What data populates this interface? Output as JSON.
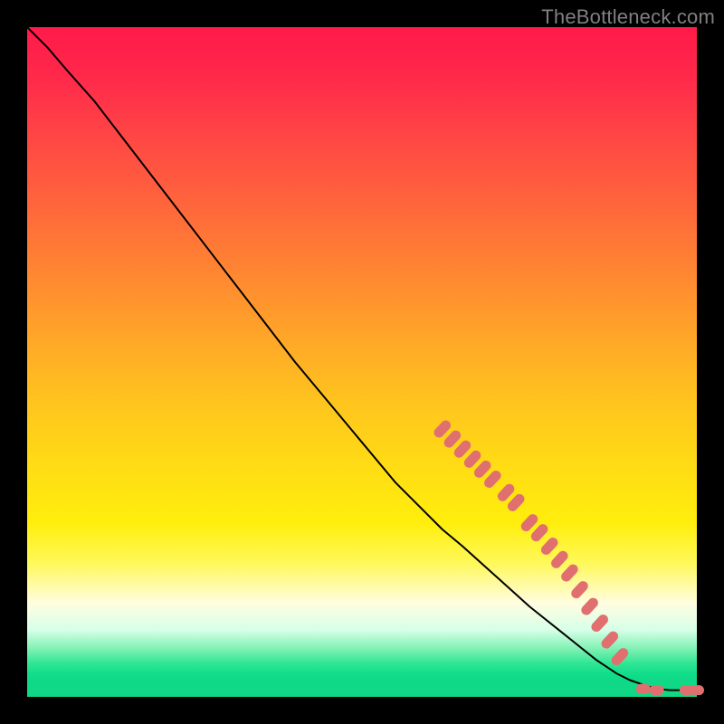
{
  "watermark": "TheBottleneck.com",
  "colors": {
    "frame": "#000000",
    "curve": "#000000",
    "marker_fill": "#e07070",
    "marker_stroke": "#b85a5a"
  },
  "chart_data": {
    "type": "line",
    "title": "",
    "xlabel": "",
    "ylabel": "",
    "xlim": [
      0,
      100
    ],
    "ylim": [
      0,
      100
    ],
    "grid": false,
    "legend": false,
    "series": [
      {
        "name": "curve",
        "x": [
          0,
          3,
          6,
          10,
          15,
          20,
          25,
          30,
          35,
          40,
          45,
          50,
          55,
          60,
          62,
          65,
          70,
          75,
          80,
          85,
          88,
          90,
          92,
          94,
          96,
          98,
          100
        ],
        "values": [
          100,
          97,
          93.5,
          89,
          82.5,
          76,
          69.5,
          63,
          56.5,
          50,
          44,
          38,
          32,
          27,
          25,
          22.5,
          18,
          13.5,
          9.5,
          5.5,
          3.5,
          2.5,
          1.8,
          1.2,
          1.0,
          1.0,
          1.0
        ]
      }
    ],
    "markers": [
      {
        "x": 62.0,
        "y": 40.0
      },
      {
        "x": 63.5,
        "y": 38.5
      },
      {
        "x": 65.0,
        "y": 37.0
      },
      {
        "x": 66.5,
        "y": 35.5
      },
      {
        "x": 68.0,
        "y": 34.0
      },
      {
        "x": 69.5,
        "y": 32.5
      },
      {
        "x": 71.5,
        "y": 30.5
      },
      {
        "x": 73.0,
        "y": 29.0
      },
      {
        "x": 75.0,
        "y": 26.0
      },
      {
        "x": 76.5,
        "y": 24.5
      },
      {
        "x": 78.0,
        "y": 22.5
      },
      {
        "x": 79.5,
        "y": 20.5
      },
      {
        "x": 81.0,
        "y": 18.5
      },
      {
        "x": 82.5,
        "y": 16.0
      },
      {
        "x": 84.0,
        "y": 13.5
      },
      {
        "x": 85.5,
        "y": 11.0
      },
      {
        "x": 87.0,
        "y": 8.5
      },
      {
        "x": 88.5,
        "y": 6.0
      },
      {
        "x": 92.0,
        "y": 1.2
      },
      {
        "x": 94.0,
        "y": 1.0
      },
      {
        "x": 98.5,
        "y": 1.0
      },
      {
        "x": 100.0,
        "y": 1.0
      }
    ]
  }
}
